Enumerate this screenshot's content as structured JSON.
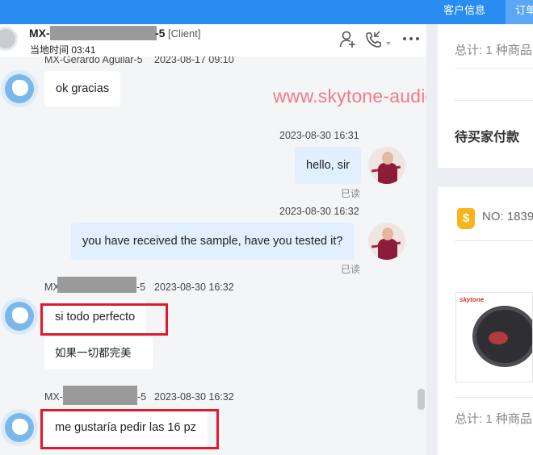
{
  "topbar": {
    "tab_customer_info": "客户信息",
    "tab_order": "订单"
  },
  "header": {
    "name_prefix": "MX-",
    "name_suffix": "-5",
    "role": "[Client]",
    "local_time": "当地时间 03:41",
    "icons": [
      "add-contact-icon",
      "phone-icon",
      "more-icon"
    ]
  },
  "messages": {
    "m0": {
      "sender": "MX-Gerardo Aguilar-5",
      "time": "2023-08-17 09:10",
      "text": "ok gracias"
    },
    "m1": {
      "time": "2023-08-30 16:31",
      "text": "hello, sir",
      "status": "已读"
    },
    "m2": {
      "time": "2023-08-30 16:32",
      "text": "you have received the sample, have you tested it?",
      "status": "已读"
    },
    "m3": {
      "sender_prefix": "MX",
      "sender_suffix": "-5",
      "time": "2023-08-30 16:32",
      "text": "si todo perfecto",
      "translation": "如果一切都完美"
    },
    "m4": {
      "sender_prefix": "MX-",
      "sender_suffix": "-5",
      "time": "2023-08-30 16:32",
      "text": "me gustaría pedir las 16 pz"
    }
  },
  "watermark": "www.skytone-audio.com",
  "right_panel": {
    "total_1": "总计: 1 种商品",
    "status": "待买家付款",
    "order_no": "NO: 1839",
    "total_2": "总计: 1 种商品",
    "coin_icon": "$",
    "product_logo": "skytone"
  },
  "colors": {
    "topbar": "#2a8cf0",
    "outgoing_bubble": "#e1efff",
    "highlight": "#e0192d",
    "watermark": "#f07a8a"
  }
}
